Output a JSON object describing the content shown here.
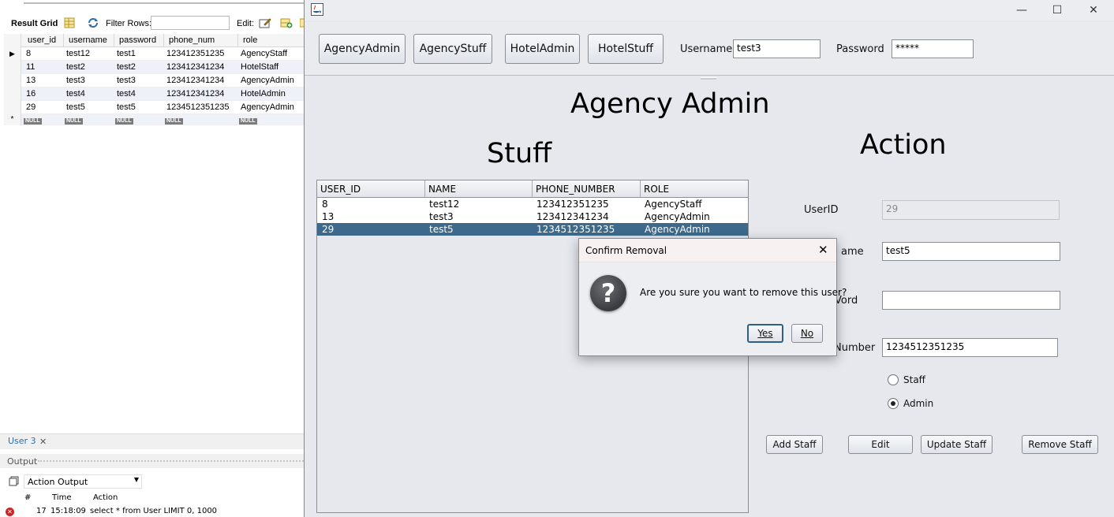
{
  "workbench": {
    "toolbar": {
      "result_grid_label": "Result Grid",
      "filter_rows_label": "Filter Rows:",
      "edit_label": "Edit:"
    },
    "grid": {
      "columns": [
        "user_id",
        "username",
        "password",
        "phone_num",
        "role"
      ],
      "rows": [
        [
          "8",
          "test12",
          "test1",
          "123412351235",
          "AgencyStaff"
        ],
        [
          "11",
          "test2",
          "test2",
          "123412341234",
          "HotelStaff"
        ],
        [
          "13",
          "test3",
          "test3",
          "123412341234",
          "AgencyAdmin"
        ],
        [
          "16",
          "test4",
          "test4",
          "123412341234",
          "HotelAdmin"
        ],
        [
          "29",
          "test5",
          "test5",
          "1234512351235",
          "AgencyAdmin"
        ]
      ],
      "null_label": "NULL",
      "new_row_marker": "*"
    },
    "tab": {
      "label": "User 3"
    },
    "output": {
      "title": "Output",
      "selector_value": "Action Output",
      "columns": [
        "#",
        "Time",
        "Action"
      ],
      "rows": [
        {
          "num": "17",
          "time": "15:18:09",
          "action": "select * from User LIMIT 0, 1000"
        }
      ]
    }
  },
  "app": {
    "top_buttons": [
      "AgencyAdmin",
      "AgencyStuff",
      "HotelAdmin",
      "HotelStuff"
    ],
    "username_label": "Username",
    "username_value": "test3",
    "password_label": "Password",
    "password_value": "*****",
    "main_title": "Agency Admin",
    "stuff_title": "Stuff",
    "action_title": "Action",
    "table": {
      "columns": [
        "USER_ID",
        "NAME",
        "PHONE_NUMBER",
        "ROLE"
      ],
      "rows": [
        [
          "8",
          "test12",
          "123412351235",
          "AgencyStaff"
        ],
        [
          "13",
          "test3",
          "123412341234",
          "AgencyAdmin"
        ],
        [
          "29",
          "test5",
          "1234512351235",
          "AgencyAdmin"
        ]
      ],
      "selected_index": 2
    },
    "form": {
      "userid_label": "UserID",
      "userid_value": "29",
      "username_label_partial": "ame",
      "username_value": "test5",
      "password_label_partial": "Vord",
      "password_value": "",
      "phone_label_partial": "Number",
      "phone_value": "1234512351235",
      "radio_staff": "Staff",
      "radio_admin": "Admin",
      "radio_selected": "Admin"
    },
    "action_buttons": {
      "add": "Add Staff",
      "edit": "Edit",
      "update": "Update Staff",
      "remove": "Remove Staff"
    }
  },
  "dialog": {
    "title": "Confirm Removal",
    "close_glyph": "✕",
    "icon_glyph": "?",
    "message": "Are you sure you want to remove this user?",
    "yes": "Yes",
    "no": "No"
  }
}
